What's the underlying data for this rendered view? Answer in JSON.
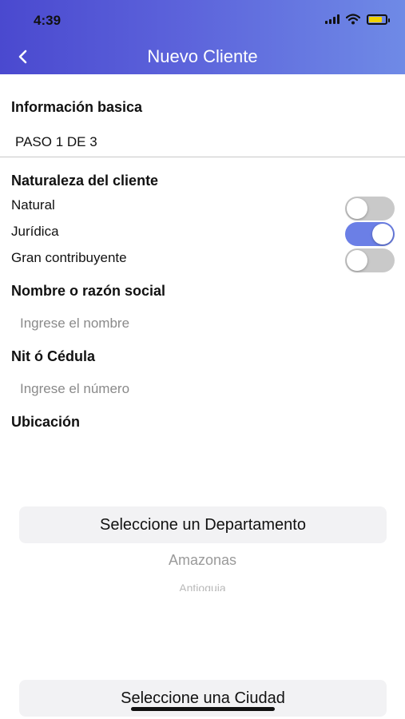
{
  "status_bar": {
    "time": "4:39"
  },
  "nav": {
    "title": "Nuevo Cliente"
  },
  "form": {
    "section_basic": "Información basica",
    "step": "PASO 1 DE 3",
    "nature_title": "Naturaleza del cliente",
    "nature_options": [
      {
        "label": "Natural",
        "on": false
      },
      {
        "label": "Jurídica",
        "on": true
      },
      {
        "label": "Gran contribuyente",
        "on": false
      }
    ],
    "name_title": "Nombre o razón social",
    "name_placeholder": "Ingrese el nombre",
    "id_title": "Nit ó Cédula",
    "id_placeholder": "Ingrese el número",
    "location_title": "Ubicación"
  },
  "pickers": {
    "department_button": "Seleccione un Departamento",
    "department_options": [
      "Amazonas",
      "Antioquia"
    ],
    "city_button": "Seleccione una Ciudad"
  },
  "colors": {
    "accent": "#6b7fe6",
    "header_start": "#4a49cf",
    "header_end": "#6f8ae6"
  }
}
